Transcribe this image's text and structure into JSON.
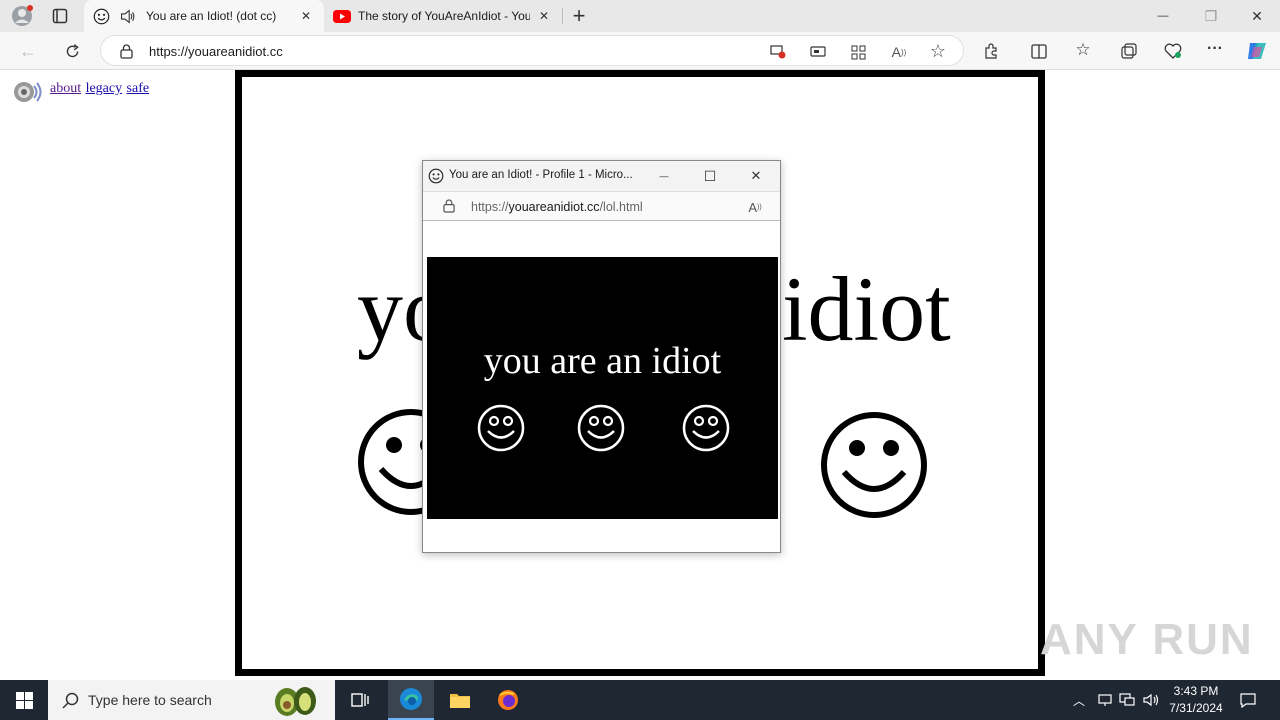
{
  "browser": {
    "tabs": [
      {
        "title": "You are an Idiot! (dot cc)",
        "favicon": "smiley-icon",
        "audio": "speaker-icon"
      },
      {
        "title": "The story of YouAreAnIdiot - You",
        "favicon": "youtube-icon"
      }
    ],
    "new_tab_label": "+",
    "url": "https://youareanidiot.cc",
    "window_controls": {
      "minimize": "—",
      "restore": "❐",
      "close": "✕"
    }
  },
  "page": {
    "links": [
      "about",
      "legacy",
      "safe"
    ],
    "headline_left": "yo",
    "headline_right": "idiot",
    "watermark": "ANY RUN"
  },
  "popup": {
    "title": "You are an Idiot! - Profile 1 - Micro...",
    "url_prefix": "https://",
    "url_domain": "youareanidiot.cc",
    "url_path": "/lol.html",
    "message": "you are an idiot",
    "controls": {
      "minimize": "—",
      "maximize": "☐",
      "close": "✕"
    }
  },
  "taskbar": {
    "search_placeholder": "Type here to search",
    "time": "3:43 PM",
    "date": "7/31/2024"
  }
}
